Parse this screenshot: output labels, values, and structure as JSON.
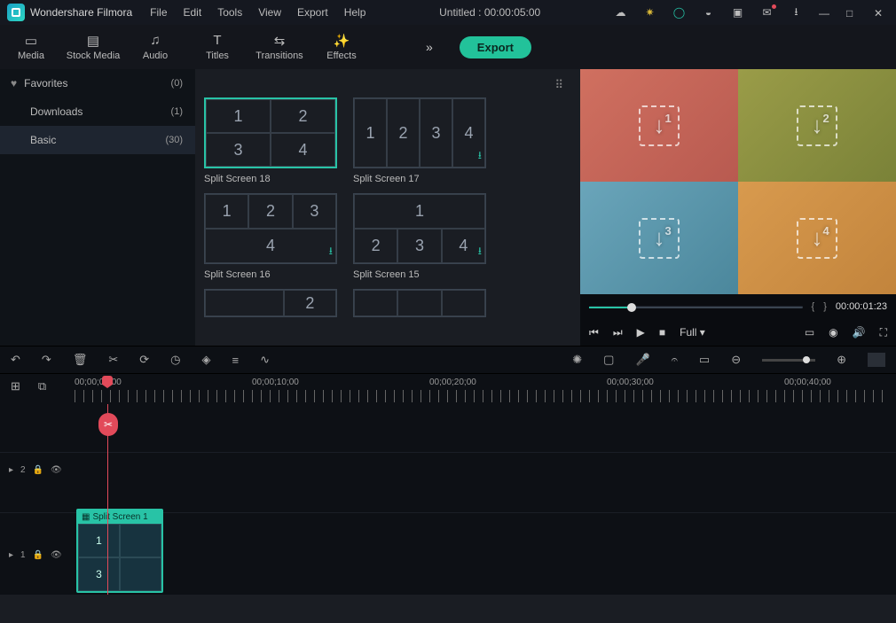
{
  "app": {
    "name": "Wondershare Filmora"
  },
  "menu": [
    "File",
    "Edit",
    "Tools",
    "View",
    "Export",
    "Help"
  ],
  "title": {
    "project": "Untitled",
    "duration": "00:00:05:00"
  },
  "tabs": [
    {
      "label": "Media",
      "icon": "folder"
    },
    {
      "label": "Stock Media",
      "icon": "image"
    },
    {
      "label": "Audio",
      "icon": "music"
    },
    {
      "label": "Titles",
      "icon": "T"
    },
    {
      "label": "Transitions",
      "icon": "transition"
    },
    {
      "label": "Effects",
      "icon": "sparkle"
    }
  ],
  "export_label": "Export",
  "sidebar": {
    "favorites": {
      "label": "Favorites",
      "count": "(0)"
    },
    "downloads": {
      "label": "Downloads",
      "count": "(1)"
    },
    "basic": {
      "label": "Basic",
      "count": "(30)"
    }
  },
  "gallery": [
    {
      "name": "Split Screen 18",
      "layout": "2x2",
      "cells": [
        "1",
        "2",
        "3",
        "4"
      ],
      "selected": true,
      "download": false
    },
    {
      "name": "Split Screen 17",
      "layout": "1x4",
      "cells": [
        "1",
        "2",
        "3",
        "4"
      ],
      "selected": false,
      "download": true
    },
    {
      "name": "Split Screen 16",
      "layout": "3plus1",
      "cells": [
        "1",
        "2",
        "3",
        "4"
      ],
      "selected": false,
      "download": true
    },
    {
      "name": "Split Screen 15",
      "layout": "1plus3",
      "cells": [
        "1",
        "2",
        "3",
        "4"
      ],
      "selected": false,
      "download": true
    },
    {
      "name": "",
      "layout": "side2",
      "cells": [
        "",
        "2"
      ],
      "selected": false,
      "download": false
    },
    {
      "name": "",
      "layout": "diag",
      "cells": [
        "",
        "",
        ""
      ],
      "selected": false,
      "download": false
    }
  ],
  "preview": {
    "quadrants": [
      "1",
      "2",
      "3",
      "4"
    ],
    "colors": [
      "#c3675f",
      "#8f9145",
      "#4f8fa5",
      "#cf8f45"
    ],
    "time": "00:00:01:23",
    "brace_l": "{",
    "brace_r": "}",
    "fit_label": "Full"
  },
  "ruler": {
    "marks": [
      "00;00;00;00",
      "00;00;10;00",
      "00;00;20;00",
      "00;00;30;00",
      "00;00;40;00"
    ],
    "positions": [
      84,
      284,
      484,
      684,
      884
    ]
  },
  "tracks": {
    "t2": "2",
    "t1": "1"
  },
  "clip": {
    "title": "Split Screen 1",
    "cells": [
      "1",
      "",
      "3",
      ""
    ]
  }
}
